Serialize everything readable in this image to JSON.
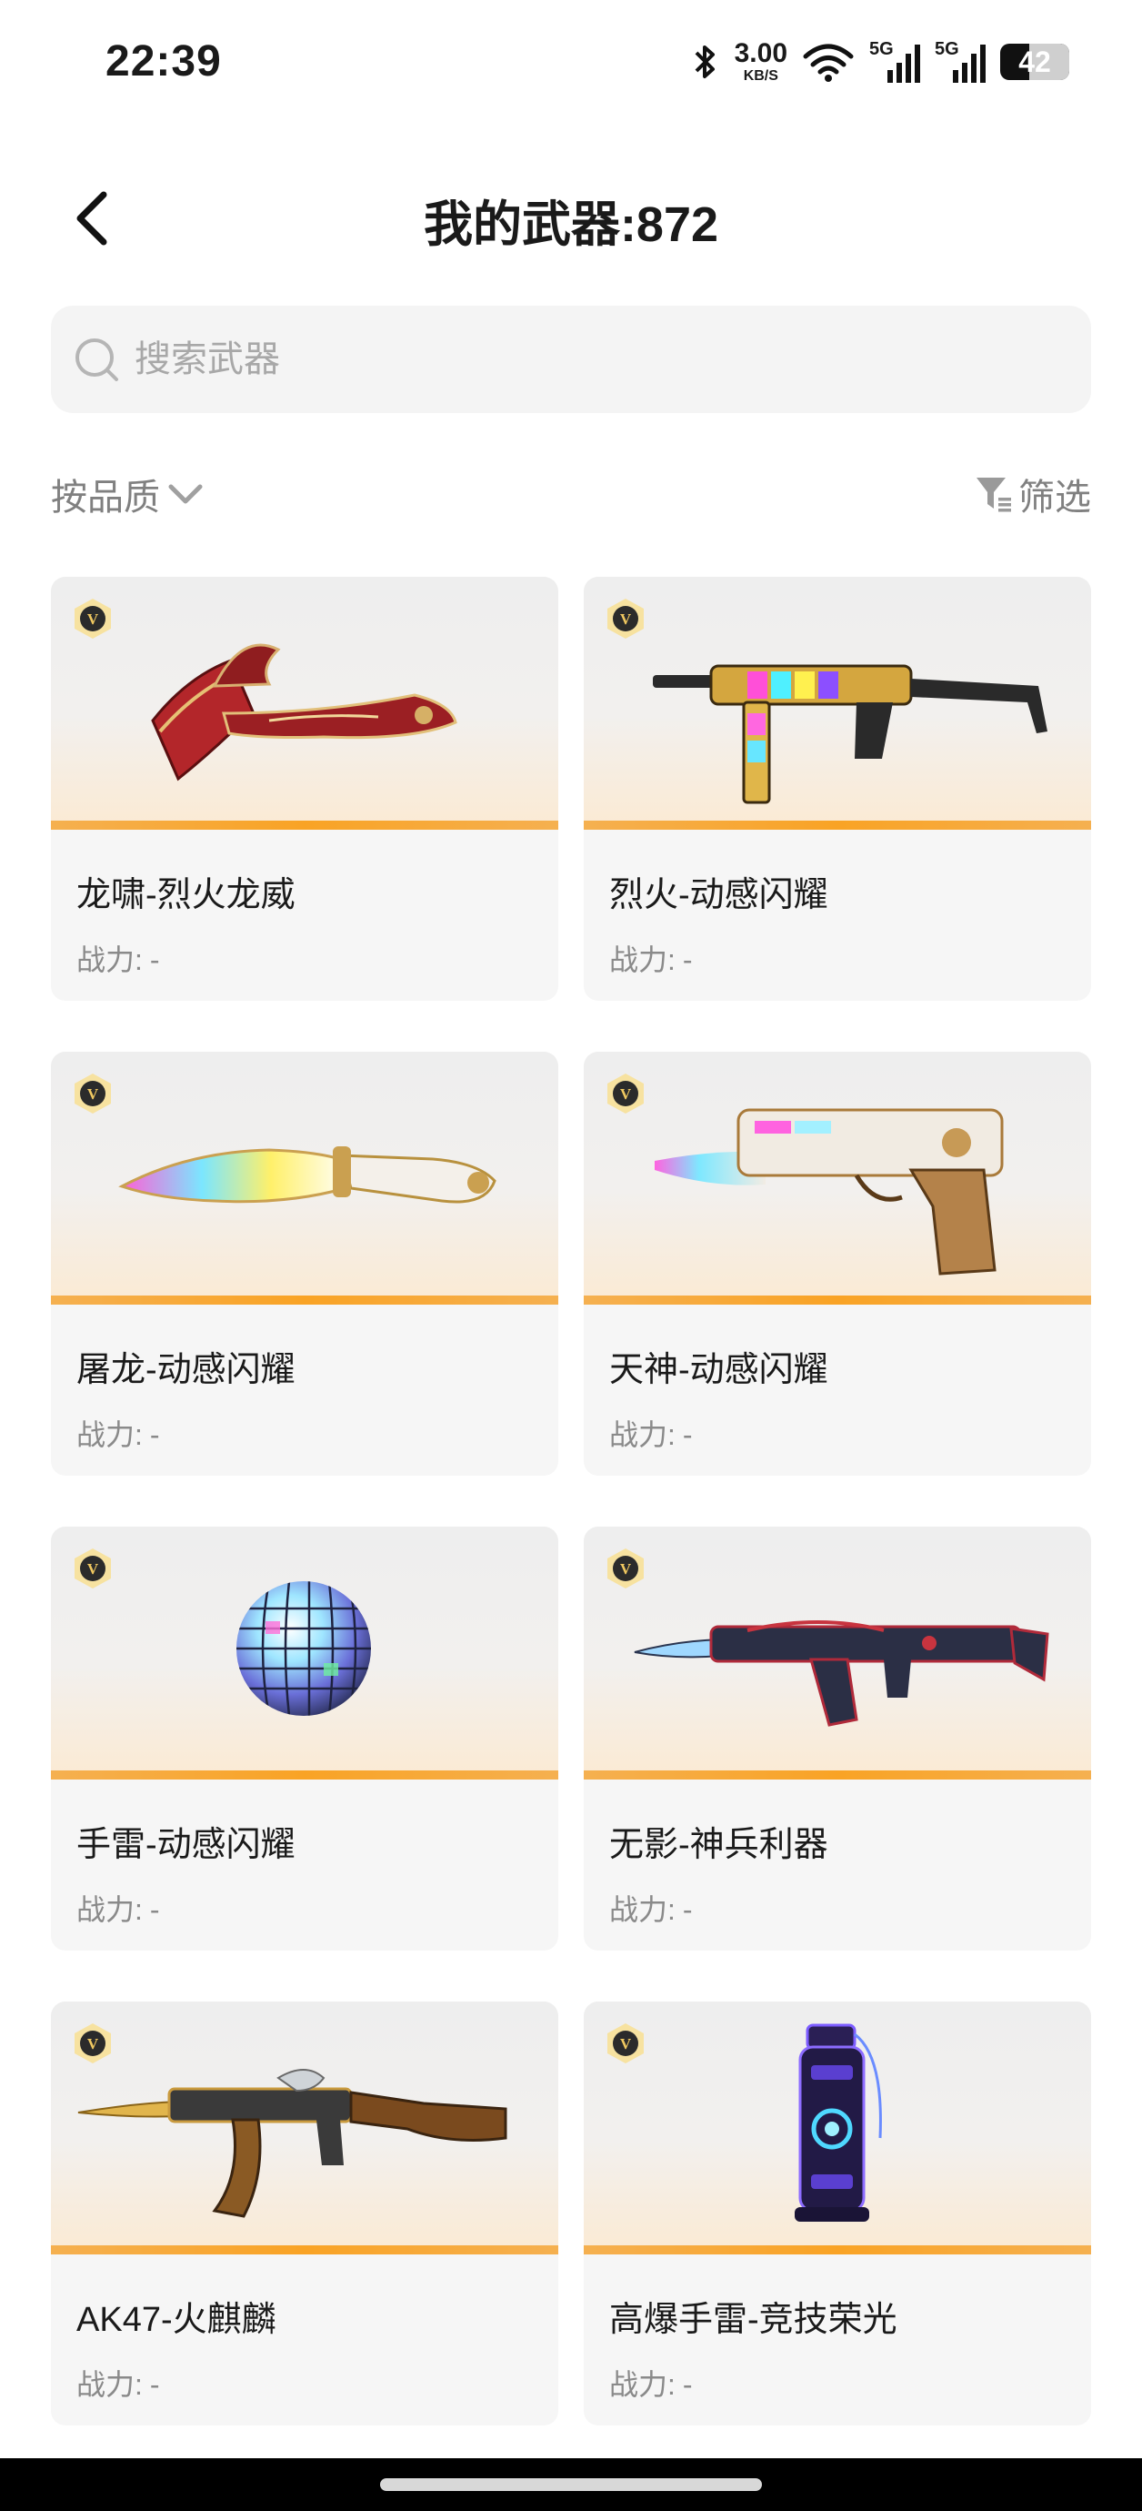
{
  "status_bar": {
    "time": "22:39",
    "net_speed_value": "3.00",
    "net_speed_unit": "KB/S",
    "signal_1_label": "5G",
    "signal_2_label": "5G",
    "battery_level": "42"
  },
  "header": {
    "title": "我的武器:872"
  },
  "search": {
    "placeholder": "搜索武器"
  },
  "filters": {
    "sort_label": "按品质",
    "filter_label": "筛选"
  },
  "weapons": [
    {
      "name": "龙啸-烈火龙威",
      "power_label": "战力:",
      "power_value": "-",
      "badge": "V",
      "icon": "axe-icon"
    },
    {
      "name": "烈火-动感闪耀",
      "power_label": "战力:",
      "power_value": "-",
      "badge": "V",
      "icon": "smg-icon"
    },
    {
      "name": "屠龙-动感闪耀",
      "power_label": "战力:",
      "power_value": "-",
      "badge": "V",
      "icon": "blade-icon"
    },
    {
      "name": "天神-动感闪耀",
      "power_label": "战力:",
      "power_value": "-",
      "badge": "V",
      "icon": "pistol-icon"
    },
    {
      "name": "手雷-动感闪耀",
      "power_label": "战力:",
      "power_value": "-",
      "badge": "V",
      "icon": "disco-grenade-icon"
    },
    {
      "name": "无影-神兵利器",
      "power_label": "战力:",
      "power_value": "-",
      "badge": "V",
      "icon": "rifle-icon"
    },
    {
      "name": "AK47-火麒麟",
      "power_label": "战力:",
      "power_value": "-",
      "badge": "V",
      "icon": "ak47-icon"
    },
    {
      "name": "高爆手雷-竞技荣光",
      "power_label": "战力:",
      "power_value": "-",
      "badge": "V",
      "icon": "canister-grenade-icon"
    }
  ],
  "colors": {
    "accent_orange": "#f9a325",
    "card_bg": "#f6f6f6",
    "search_bg": "#f4f4f4",
    "muted_text": "#8a8a8a"
  }
}
